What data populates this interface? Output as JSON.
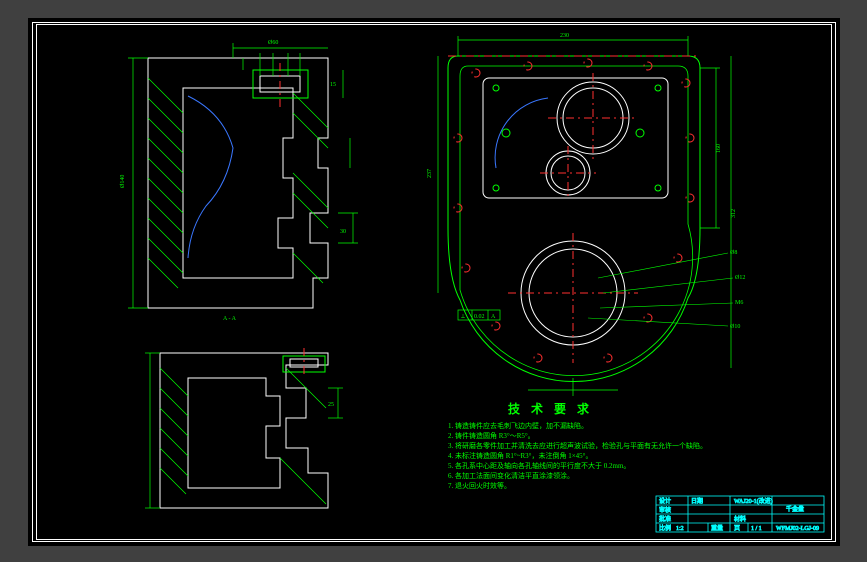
{
  "drawing": {
    "requirements_title": "技 术 要 求",
    "requirements": [
      "1. 铸造铸件应去毛刺飞边内壁，加不漏缺陷。",
      "2. 铸件铸造圆角 R3°～R5°。",
      "3. 将研磨各零件加工并清洗去应进行超声波试验，检验孔与平面有无允许一个缺陷。",
      "4. 未标注铸造圆角 R1°~R3°，未注倒角 1×45°。",
      "5. 各孔系中心距及轴向各孔轴线间的平行度不大于 0.2mm。",
      "6. 各加工法面间变化清洁平直涂漆领涂。",
      "7. 退火回火时效等。"
    ],
    "section_label": "A - A",
    "titleblock": {
      "doc_no": "WFMJ02-LGJ-09",
      "scale_label": "比例",
      "scale_value": "1:2",
      "mass_label": "重量",
      "sheet_label": "页",
      "drawing_name": "千金盘",
      "project": "WAJ20-1(改进)",
      "design_label": "设计",
      "check_label": "审核",
      "approve_label": "批准",
      "date_label": "日期",
      "material_label": "材料",
      "page_val": "1 / 1"
    }
  }
}
